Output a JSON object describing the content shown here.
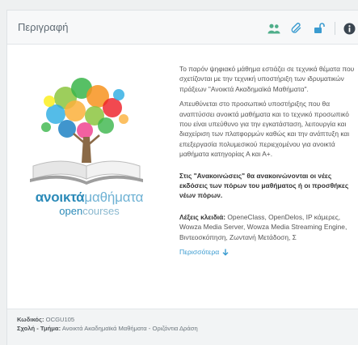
{
  "panel": {
    "title": "Περιγραφή",
    "icons": [
      "users-icon",
      "paperclip-icon",
      "unlock-icon",
      "info-icon"
    ],
    "accent_color": "#3a9bd0"
  },
  "logo": {
    "word_bold": "ανοικτά",
    "word_light": "μαθήματα",
    "sub_open": "open",
    "sub_rest": "courses"
  },
  "description": {
    "para1": "Το παρόν ψηφιακό μάθημα εστιάζει σε τεχνικά θέματα που σχετίζονται με την τεχνική υποστήριξη των ιδρυματικών πράξεων \"Ανοικτά Ακαδημαϊκά Μαθήματα\".",
    "para2": "Απευθύνεται στο προσωπικό υποστήριξης που θα αναπτύσσει ανοικτά μαθήματα και το τεχνικό προσωπικό που είναι υπεύθυνο για την εγκατάσταση, λειτουργία και διαχείριση των πλατφορμών καθώς και την ανάπτυξη και επεξεργασία πολυμεσικού περιεχομένου για ανοικτά μαθήματα κατηγορίας Α και Α+.",
    "announcement": "Στις \"Ανακοινώσεις\" θα ανακοινώνονται οι νέες εκδόσεις των πόρων του μαθήματος ή οι προσθήκες νέων πόρων.",
    "keywords_label": "Λέξεις κλειδιά:",
    "keywords": "OpeneClass, OpenDelos, IP κάμερες, Wowza Media Server, Wowza Media Streaming Engine, Βιντεοσκόπηση, Ζωντανή Μετάδοση, Σ",
    "more_label": "Περισσότερα"
  },
  "footer": {
    "code_label": "Κωδικός:",
    "code_value": "OCGU105",
    "school_label": "Σχολή - Τμήμα:",
    "school_value": "Ανοικτά Ακαδημαϊκά Μαθήματα - Οριζόντια Δράση"
  }
}
